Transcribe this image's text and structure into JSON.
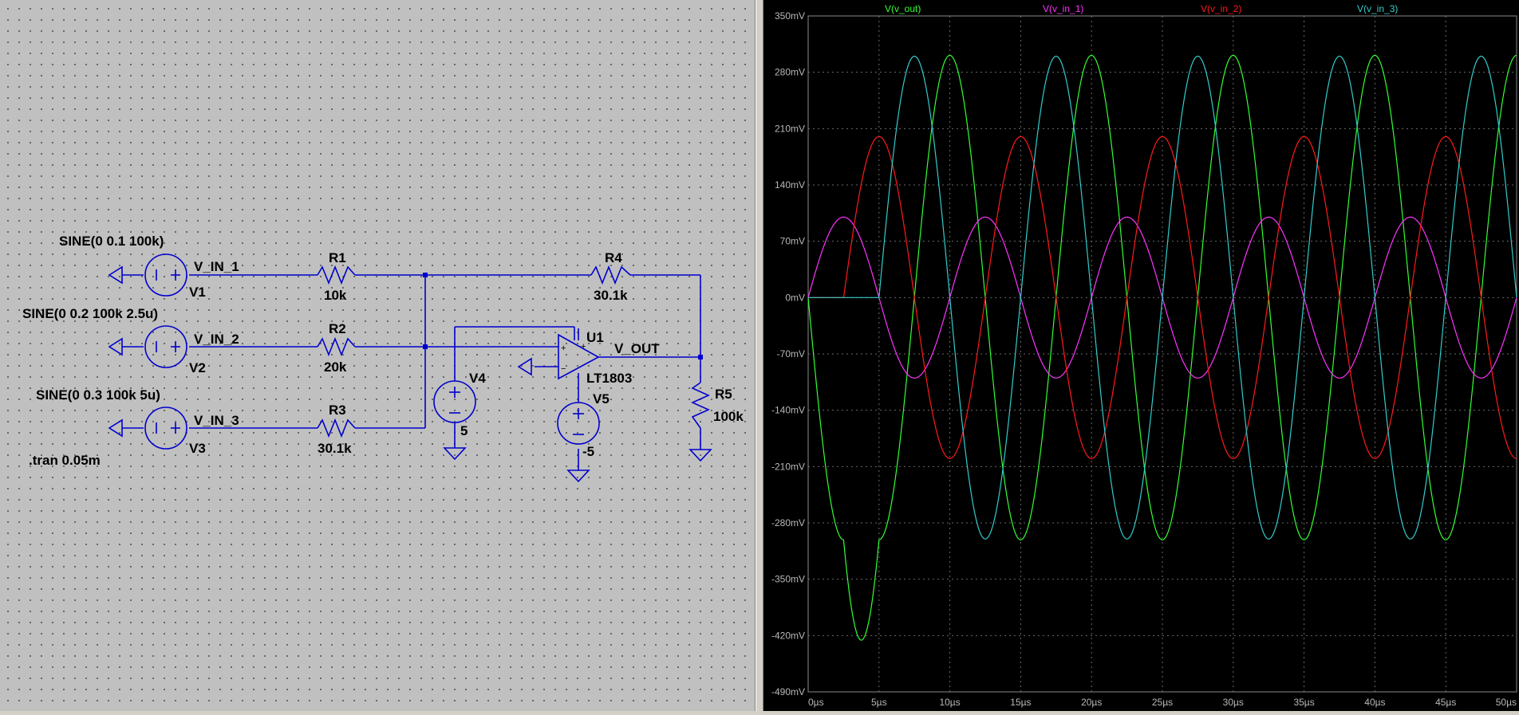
{
  "schematic": {
    "sources": [
      {
        "name": "V1",
        "value": "SINE(0 0.1 100k)",
        "net": "V_IN_1"
      },
      {
        "name": "V2",
        "value": "SINE(0 0.2 100k 2.5u)",
        "net": "V_IN_2"
      },
      {
        "name": "V3",
        "value": "SINE(0 0.3 100k 5u)",
        "net": "V_IN_3"
      }
    ],
    "resistors": [
      {
        "name": "R1",
        "value": "10k"
      },
      {
        "name": "R2",
        "value": "20k"
      },
      {
        "name": "R3",
        "value": "30.1k"
      },
      {
        "name": "R4",
        "value": "30.1k"
      },
      {
        "name": "R5",
        "value": "100k"
      }
    ],
    "supplies": [
      {
        "name": "V4",
        "value": "5"
      },
      {
        "name": "V5",
        "value": "-5"
      }
    ],
    "opamp": {
      "name": "U1",
      "model": "LT1803"
    },
    "output_net": "V_OUT",
    "directive": ".tran 0.05m"
  },
  "waveform": {
    "background": "#000000",
    "grid_color": "#6a6a6a",
    "y_ticks": [
      "350mV",
      "280mV",
      "210mV",
      "140mV",
      "70mV",
      "0mV",
      "-70mV",
      "-140mV",
      "-210mV",
      "-280mV",
      "-350mV",
      "-420mV",
      "-490mV"
    ],
    "x_ticks": [
      "0µs",
      "5µs",
      "10µs",
      "15µs",
      "20µs",
      "25µs",
      "30µs",
      "35µs",
      "40µs",
      "45µs",
      "50µs"
    ]
  },
  "chart_data": {
    "type": "line",
    "xlabel": "",
    "ylabel": "",
    "x_unit": "µs",
    "y_unit": "mV",
    "xlim": [
      0,
      50
    ],
    "ylim": [
      -490,
      350
    ],
    "grid": true,
    "legend": "top",
    "series": [
      {
        "name": "V(v_out)",
        "color": "#33ff33",
        "amplitude_mV": 295,
        "frequency_kHz": 100,
        "start_us": 0,
        "description_points": [
          [
            0,
            0
          ],
          [
            3.9,
            -425
          ],
          [
            7.1,
            -290
          ],
          [
            10,
            295
          ],
          [
            15,
            -295
          ],
          [
            20,
            295
          ],
          [
            25,
            -295
          ],
          [
            30,
            295
          ],
          [
            35,
            -295
          ],
          [
            40,
            295
          ],
          [
            45,
            -295
          ],
          [
            50,
            295
          ]
        ]
      },
      {
        "name": "V(v_in_1)",
        "color": "#ff33ff",
        "amplitude_mV": 100,
        "frequency_kHz": 100,
        "delay_us": 0
      },
      {
        "name": "V(v_in_2)",
        "color": "#ff1a1a",
        "amplitude_mV": 200,
        "frequency_kHz": 100,
        "delay_us": 2.5
      },
      {
        "name": "V(v_in_3)",
        "color": "#33cccc",
        "amplitude_mV": 300,
        "frequency_kHz": 100,
        "delay_us": 5
      }
    ]
  }
}
